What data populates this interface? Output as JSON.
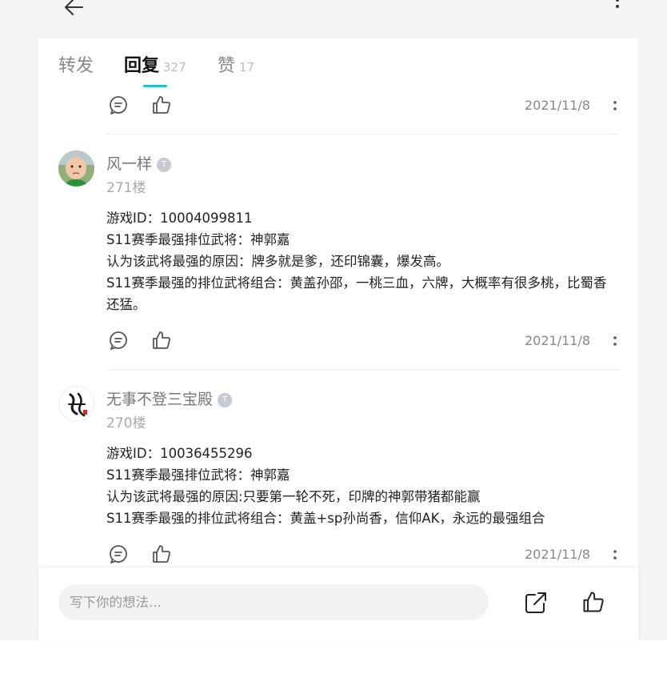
{
  "tabs": [
    {
      "label": "转发",
      "count": ""
    },
    {
      "label": "回复",
      "count": "327"
    },
    {
      "label": "赞",
      "count": "17"
    }
  ],
  "top_item": {
    "date": "2021/11/8"
  },
  "replies": [
    {
      "username": "风一样",
      "level_badge": "T",
      "floor": "271楼",
      "lines": [
        "游戏ID：10004099811",
        "S11赛季最强排位武将：神郭嘉",
        "认为该武将最强的原因：牌多就是爹，还印锦囊，爆发高。",
        "S11赛季最强的排位武将组合：黄盖孙邵，一桃三血，六牌，大概率有很多桃，比蜀香还猛。"
      ],
      "date": "2021/11/8"
    },
    {
      "username": "无事不登三宝殿",
      "level_badge": "T",
      "floor": "270楼",
      "lines": [
        "游戏ID：10036455296",
        "S11赛季最强排位武将：神郭嘉",
        "认为该武将最强的原因:只要第一轮不死，印牌的神郭带猪都能赢",
        "S11赛季最强的排位武将组合：黄盖+sp孙尚香，信仰AK，永远的最强组合"
      ],
      "date": "2021/11/8"
    }
  ],
  "composer": {
    "placeholder": "写下你的想法..."
  },
  "icons": {
    "back": "back-arrow-icon",
    "more": "more-vertical-icon",
    "comment": "comment-icon",
    "like": "thumbs-up-icon",
    "share": "share-icon"
  },
  "colors": {
    "accent": "#1fc2c9",
    "date": "#888888",
    "level_badge": "#c5cad3"
  }
}
